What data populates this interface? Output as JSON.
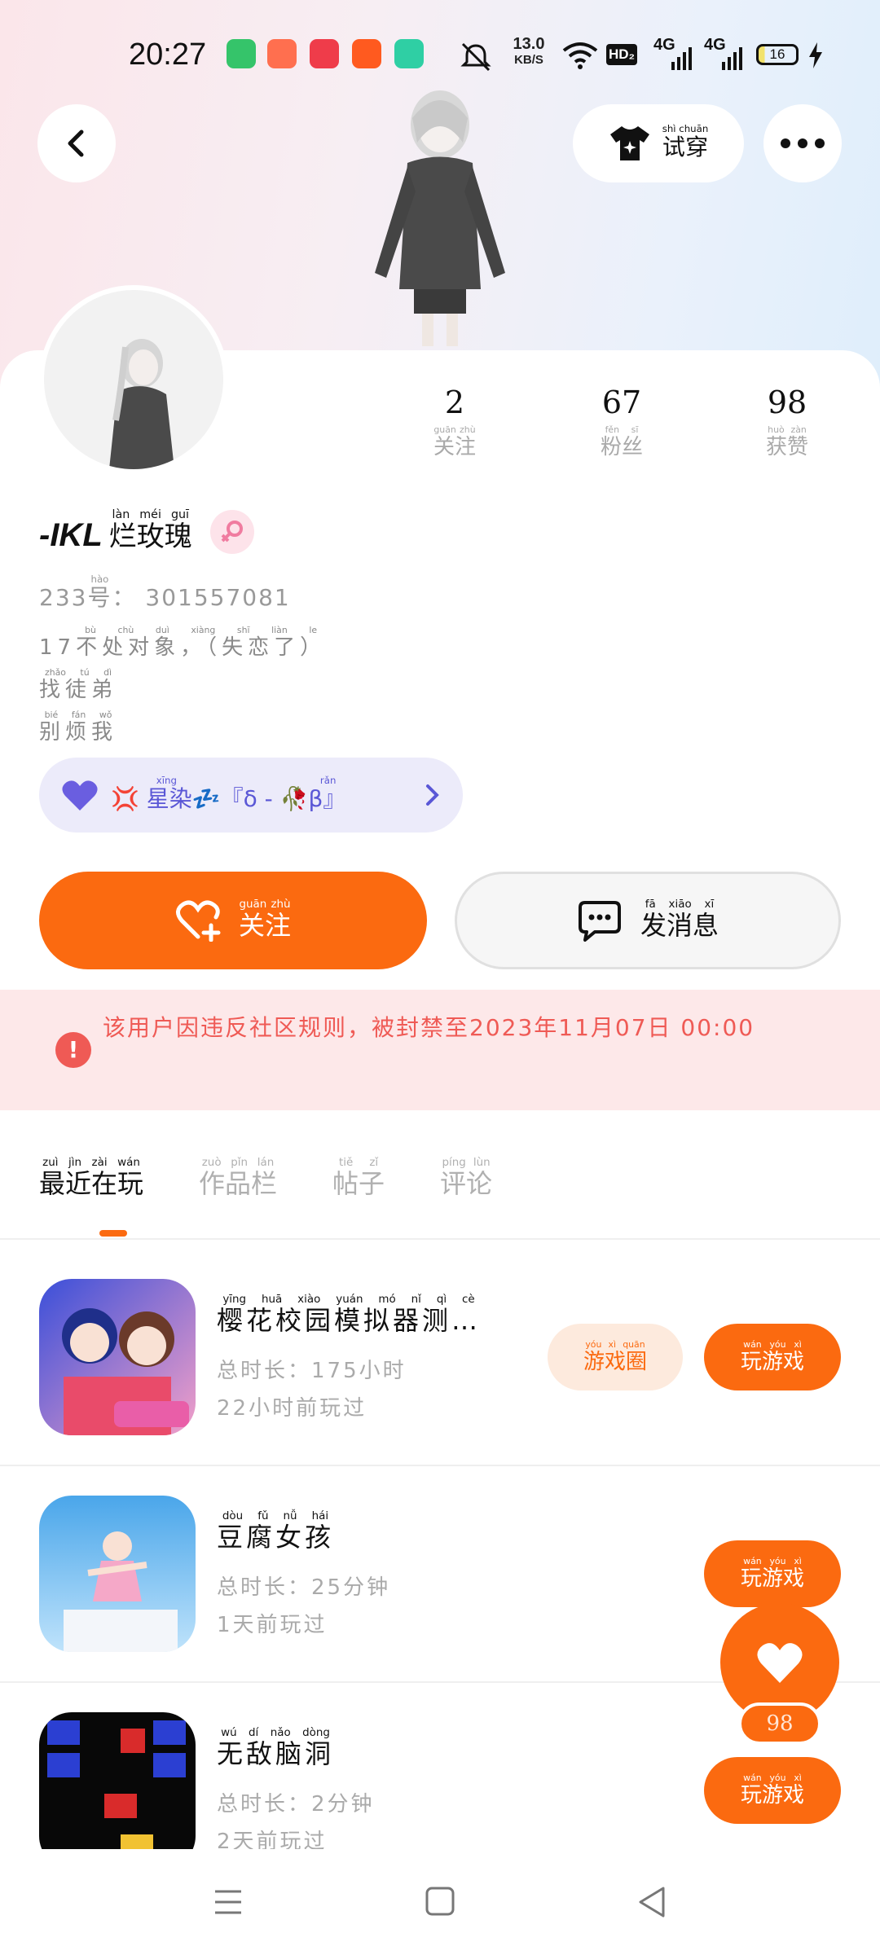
{
  "status": {
    "time": "20:27",
    "net_speed_value": "13.0",
    "net_speed_unit": "KB/S",
    "hd": "HD₂",
    "sig1": "4G",
    "sig2": "4G",
    "battery": "16"
  },
  "header": {
    "tryon_label": "试穿",
    "tryon_pinyin": "shì chuān"
  },
  "stats": [
    {
      "value": "2",
      "label": "关注",
      "pinyin": "guān zhù"
    },
    {
      "value": "67",
      "label": "粉丝",
      "pinyin": "fěn sī"
    },
    {
      "value": "98",
      "label": "获赞",
      "pinyin": "huò zàn"
    }
  ],
  "profile": {
    "name_latin": "-IKL",
    "name_cn": "烂玫瑰",
    "name_pinyin": "làn méi guī",
    "uid_prefix": "233",
    "uid_hao": "号",
    "uid_hao_pinyin": "hào",
    "uid_value": "301557081",
    "bio_line1_num": "17",
    "bio_line1_cn": "不处对象，（失恋了）",
    "bio_line1_pinyin": "bù chù duì xiàng   shī liàn le",
    "bio_line2": "找徒弟",
    "bio_line2_pinyin": "zhǎo tú dì",
    "bio_line3": "别烦我",
    "bio_line3_pinyin": "bié fán wǒ",
    "clan_text": "星染💤『δ - 🥀β』",
    "clan_pinyin": "xīng rǎn"
  },
  "actions": {
    "follow": "关注",
    "follow_pinyin": "guān zhù",
    "message": "发消息",
    "message_pinyin": "fā xiāo xī"
  },
  "ban": {
    "text": "该用户因违反社区规则，被封禁至2023年11月07日 00:00"
  },
  "tabs": [
    {
      "label": "最近在玩",
      "pinyin": "zuì jìn zài wán"
    },
    {
      "label": "作品栏",
      "pinyin": "zuò pǐn lán"
    },
    {
      "label": "帖子",
      "pinyin": "tiě zǐ"
    },
    {
      "label": "评论",
      "pinyin": "píng lùn"
    }
  ],
  "games": [
    {
      "title": "樱花校园模拟器测…",
      "title_pinyin": "yīng huā xiào yuán mó nǐ qì cè",
      "duration": "总时长：175小时",
      "last": "22小时前玩过",
      "circle": "游戏圈",
      "circle_pinyin": "yóu xì quān",
      "play": "玩游戏",
      "play_pinyin": "wán yóu xì"
    },
    {
      "title": "豆腐女孩",
      "title_pinyin": "dòu fǔ nǚ hái",
      "duration": "总时长：25分钟",
      "last": "1天前玩过",
      "play": "玩游戏",
      "play_pinyin": "wán yóu xì"
    },
    {
      "title": "无敌脑洞",
      "title_pinyin": "wú dí nǎo dòng",
      "duration": "总时长：2分钟",
      "last": "2天前玩过",
      "play": "玩游戏",
      "play_pinyin": "wán yóu xì"
    }
  ],
  "like_fab": {
    "count": "98"
  },
  "colors": {
    "accent": "#fb6a10",
    "ban": "#ef5a55",
    "clan": "#5a57d6"
  }
}
